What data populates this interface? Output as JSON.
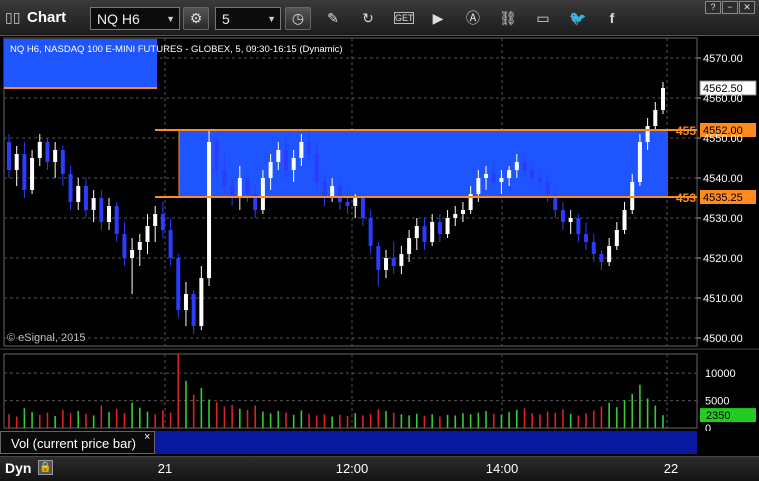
{
  "toolbar": {
    "title": "Chart",
    "symbol": "NQ H6",
    "interval": "5"
  },
  "chart_data": {
    "type": "candlestick",
    "title": "NQ H6, NASDAQ 100 E-MINI FUTURES - GLOBEX, 5, 09:30-16:15 (Dynamic)",
    "watermark": "© eSignal, 2015",
    "ylim": [
      4498,
      4575
    ],
    "y_ticks": [
      "4570.00",
      "4560.00",
      "4550.00",
      "4540.00",
      "4530.00",
      "4520.00",
      "4510.00",
      "4500.00"
    ],
    "x_ticks": [
      "21",
      "12:00",
      "14:00",
      "22"
    ],
    "last_price": "4562.50",
    "levels": [
      {
        "value": 4552.0,
        "label": "4552.00",
        "left_label": "455",
        "color": "#ff8a1e"
      },
      {
        "value": 4535.25,
        "label": "4535.25",
        "left_label": "453",
        "color": "#ff8a1e"
      }
    ],
    "zone": {
      "from": 4535.25,
      "to": 4552.0,
      "color": "#1f55ff"
    },
    "up_color": "#ffffff",
    "down_color": "#2a3cff",
    "candles": [
      [
        4549,
        4551,
        4540,
        4542
      ],
      [
        4542,
        4548,
        4538,
        4546
      ],
      [
        4546,
        4549,
        4535,
        4537
      ],
      [
        4537,
        4547,
        4536,
        4545
      ],
      [
        4545,
        4551,
        4543,
        4549
      ],
      [
        4549,
        4550,
        4542,
        4544
      ],
      [
        4544,
        4549,
        4540,
        4547
      ],
      [
        4547,
        4548,
        4538,
        4541
      ],
      [
        4541,
        4543,
        4532,
        4534
      ],
      [
        4534,
        4540,
        4532,
        4538
      ],
      [
        4538,
        4540,
        4530,
        4532
      ],
      [
        4532,
        4537,
        4529,
        4535
      ],
      [
        4535,
        4537,
        4527,
        4529
      ],
      [
        4529,
        4535,
        4527,
        4533
      ],
      [
        4533,
        4534,
        4524,
        4526
      ],
      [
        4526,
        4529,
        4518,
        4520
      ],
      [
        4520,
        4525,
        4511,
        4522
      ],
      [
        4522,
        4526,
        4518,
        4524
      ],
      [
        4524,
        4531,
        4521,
        4528
      ],
      [
        4528,
        4533,
        4524,
        4531
      ],
      [
        4531,
        4534,
        4525,
        4527
      ],
      [
        4527,
        4530,
        4518,
        4520
      ],
      [
        4520,
        4521,
        4505,
        4507
      ],
      [
        4507,
        4514,
        4503,
        4511
      ],
      [
        4511,
        4512,
        4501,
        4503
      ],
      [
        4503,
        4518,
        4502,
        4515
      ],
      [
        4515,
        4552,
        4513,
        4549
      ],
      [
        4549,
        4551,
        4540,
        4542
      ],
      [
        4542,
        4546,
        4536,
        4538
      ],
      [
        4538,
        4540,
        4533,
        4535
      ],
      [
        4535,
        4543,
        4532,
        4540
      ],
      [
        4540,
        4541,
        4534,
        4536
      ],
      [
        4536,
        4538,
        4530,
        4532
      ],
      [
        4532,
        4542,
        4531,
        4540
      ],
      [
        4540,
        4546,
        4537,
        4544
      ],
      [
        4544,
        4549,
        4542,
        4547
      ],
      [
        4547,
        4550,
        4540,
        4542
      ],
      [
        4542,
        4547,
        4539,
        4545
      ],
      [
        4545,
        4551,
        4543,
        4549
      ],
      [
        4549,
        4552,
        4544,
        4546
      ],
      [
        4546,
        4549,
        4537,
        4539
      ],
      [
        4539,
        4541,
        4533,
        4535
      ],
      [
        4535,
        4540,
        4534,
        4538
      ],
      [
        4538,
        4540,
        4532,
        4534
      ],
      [
        4534,
        4538,
        4531,
        4533
      ],
      [
        4533,
        4536,
        4530,
        4535
      ],
      [
        4535,
        4536,
        4528,
        4530
      ],
      [
        4530,
        4532,
        4521,
        4523
      ],
      [
        4523,
        4524,
        4513,
        4517
      ],
      [
        4517,
        4522,
        4515,
        4520
      ],
      [
        4520,
        4524,
        4516,
        4518
      ],
      [
        4518,
        4523,
        4516,
        4521
      ],
      [
        4521,
        4527,
        4519,
        4525
      ],
      [
        4525,
        4530,
        4522,
        4528
      ],
      [
        4528,
        4530,
        4522,
        4524
      ],
      [
        4524,
        4531,
        4523,
        4529
      ],
      [
        4529,
        4531,
        4524,
        4526
      ],
      [
        4526,
        4532,
        4525,
        4530
      ],
      [
        4530,
        4533,
        4528,
        4531
      ],
      [
        4531,
        4534,
        4529,
        4532
      ],
      [
        4532,
        4538,
        4531,
        4536
      ],
      [
        4536,
        4542,
        4534,
        4540
      ],
      [
        4540,
        4543,
        4537,
        4541
      ],
      [
        4541,
        4544,
        4538,
        4539
      ],
      [
        4539,
        4542,
        4536,
        4540
      ],
      [
        4540,
        4543,
        4538,
        4542
      ],
      [
        4542,
        4546,
        4540,
        4544
      ],
      [
        4544,
        4545,
        4540,
        4542
      ],
      [
        4542,
        4544,
        4538,
        4540
      ],
      [
        4540,
        4542,
        4537,
        4539
      ],
      [
        4539,
        4541,
        4534,
        4536
      ],
      [
        4536,
        4538,
        4530,
        4532
      ],
      [
        4532,
        4534,
        4527,
        4529
      ],
      [
        4529,
        4532,
        4526,
        4530
      ],
      [
        4530,
        4531,
        4524,
        4526
      ],
      [
        4526,
        4529,
        4522,
        4524
      ],
      [
        4524,
        4526,
        4519,
        4521
      ],
      [
        4521,
        4522,
        4517,
        4519
      ],
      [
        4519,
        4525,
        4518,
        4523
      ],
      [
        4523,
        4529,
        4522,
        4527
      ],
      [
        4527,
        4534,
        4526,
        4532
      ],
      [
        4532,
        4541,
        4531,
        4539
      ],
      [
        4539,
        4551,
        4538,
        4549
      ],
      [
        4549,
        4555,
        4547,
        4553
      ],
      [
        4553,
        4559,
        4552,
        4557
      ],
      [
        4557,
        4564,
        4556,
        4562.5
      ]
    ],
    "volume": {
      "ylim": [
        0,
        13500
      ],
      "y_ticks": [
        "10000",
        "5000",
        "0"
      ],
      "current": "2350",
      "current_color": "#22cc22",
      "values": [
        2500,
        2100,
        3600,
        2900,
        2400,
        2800,
        2200,
        3300,
        2700,
        3100,
        2600,
        2300,
        4100,
        2900,
        3500,
        2700,
        4600,
        3700,
        3000,
        2500,
        3200,
        2800,
        13700,
        8600,
        6100,
        7300,
        5200,
        4700,
        3900,
        4200,
        3500,
        3300,
        4100,
        3000,
        2700,
        3100,
        2800,
        2400,
        3200,
        2600,
        2300,
        2500,
        2100,
        2400,
        2200,
        2700,
        2300,
        2600,
        3400,
        3100,
        2800,
        2500,
        2300,
        2600,
        2200,
        2500,
        2100,
        2400,
        2300,
        2700,
        2500,
        2800,
        3100,
        2600,
        2400,
        2900,
        3300,
        3600,
        2700,
        2500,
        3000,
        2800,
        3400,
        2600,
        2300,
        2700,
        3200,
        3900,
        4600,
        3800,
        5100,
        6200,
        7900,
        5400,
        4100,
        2350
      ],
      "up_flags": [
        0,
        0,
        1,
        1,
        0,
        0,
        1,
        0,
        0,
        1,
        0,
        1,
        0,
        1,
        0,
        0,
        1,
        1,
        1,
        0,
        0,
        0,
        0,
        1,
        0,
        1,
        1,
        0,
        0,
        0,
        1,
        0,
        0,
        1,
        1,
        1,
        0,
        1,
        1,
        0,
        0,
        0,
        1,
        0,
        0,
        1,
        0,
        0,
        0,
        1,
        0,
        1,
        1,
        1,
        0,
        1,
        0,
        1,
        1,
        1,
        1,
        1,
        1,
        0,
        1,
        1,
        1,
        0,
        0,
        0,
        0,
        0,
        0,
        1,
        0,
        0,
        0,
        0,
        1,
        1,
        1,
        1,
        1,
        1,
        1,
        1
      ]
    },
    "vol_label": "Vol (current price bar)",
    "close_symbol": "×"
  },
  "bottom": {
    "mode": "Dyn",
    "lock": "🔒"
  }
}
